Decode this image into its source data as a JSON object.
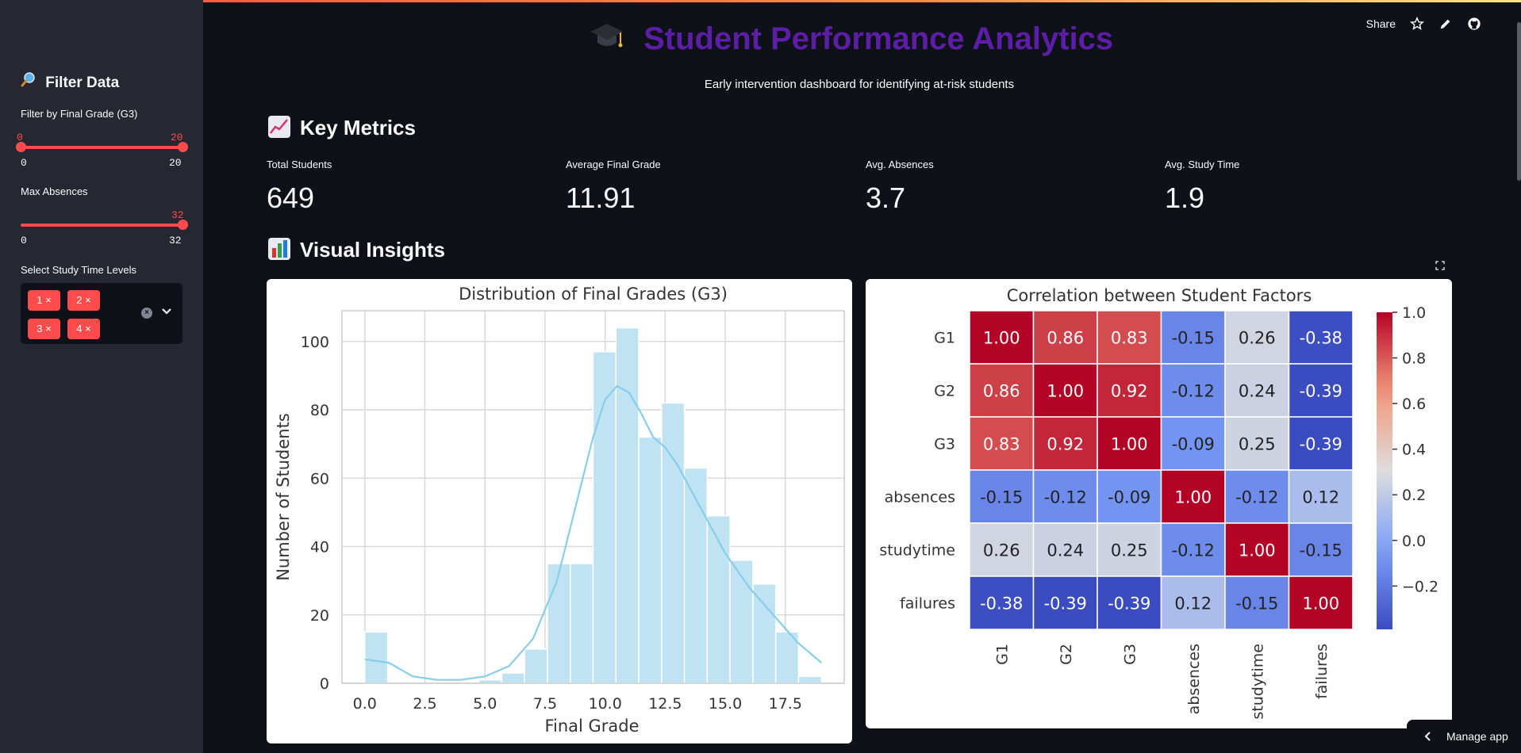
{
  "toolbar": {
    "share_label": "Share"
  },
  "sidebar": {
    "title": "Filter Data",
    "grade_filter": {
      "label": "Filter by Final Grade (G3)",
      "value_low": "0",
      "value_high": "20",
      "min": "0",
      "max": "20"
    },
    "absences_filter": {
      "label": "Max Absences",
      "value": "32",
      "min": "0",
      "max": "32"
    },
    "studytime_filter": {
      "label": "Select Study Time Levels",
      "chips": [
        "1",
        "2",
        "3",
        "4"
      ],
      "chip_close": "×"
    }
  },
  "header": {
    "icon": "graduation-cap-icon",
    "title": "Student Performance Analytics",
    "subtitle": "Early intervention dashboard for identifying at-risk students",
    "title_color": "#5d1ea7"
  },
  "key_metrics": {
    "title": "Key Metrics",
    "items": [
      {
        "label": "Total Students",
        "value": "649"
      },
      {
        "label": "Average Final Grade",
        "value": "11.91"
      },
      {
        "label": "Avg. Absences",
        "value": "3.7"
      },
      {
        "label": "Avg. Study Time",
        "value": "1.9"
      }
    ]
  },
  "visual_insights": {
    "title": "Visual Insights"
  },
  "manage_app_label": "Manage app",
  "accent_color": "#ff4b4b",
  "chart_data": [
    {
      "type": "bar",
      "title": "Distribution of Final Grades (G3)",
      "xlabel": "Final Grade",
      "ylabel": "Number of Students",
      "bin_edges": [
        0,
        0.95,
        1.9,
        2.85,
        3.8,
        4.75,
        5.7,
        6.65,
        7.6,
        8.55,
        9.5,
        10.45,
        11.4,
        12.35,
        13.3,
        14.25,
        15.2,
        16.15,
        17.1,
        18.05,
        19
      ],
      "values": [
        15,
        0,
        0,
        0,
        0,
        1,
        3,
        10,
        35,
        35,
        97,
        104,
        72,
        82,
        63,
        49,
        36,
        29,
        15,
        2
      ],
      "kde": {
        "x": [
          0,
          1,
          2,
          3,
          4,
          5,
          6,
          7,
          8,
          9,
          9.5,
          10,
          10.5,
          11,
          11.5,
          12,
          12.5,
          13,
          14,
          15,
          16,
          17,
          18,
          19
        ],
        "y": [
          7,
          6,
          2,
          1,
          1,
          2,
          5,
          13,
          30,
          58,
          72,
          83,
          87,
          85,
          79,
          72,
          69,
          64,
          51,
          38,
          28,
          20,
          12,
          6
        ]
      },
      "xlim": [
        -0.95,
        19.95
      ],
      "ylim": [
        0,
        109
      ],
      "xticks": [
        "0.0",
        "2.5",
        "5.0",
        "7.5",
        "10.0",
        "12.5",
        "15.0",
        "17.5"
      ],
      "yticks": [
        "0",
        "20",
        "40",
        "60",
        "80",
        "100"
      ],
      "grid": true,
      "bar_color": "#bfe3f2",
      "line_color": "#87ceeb"
    },
    {
      "type": "heatmap",
      "title": "Correlation between Student Factors",
      "rows": [
        "G1",
        "G2",
        "G3",
        "absences",
        "studytime",
        "failures"
      ],
      "cols": [
        "G1",
        "G2",
        "G3",
        "absences",
        "studytime",
        "failures"
      ],
      "values": [
        [
          1.0,
          0.86,
          0.83,
          -0.15,
          0.26,
          -0.38
        ],
        [
          0.86,
          1.0,
          0.92,
          -0.12,
          0.24,
          -0.39
        ],
        [
          0.83,
          0.92,
          1.0,
          -0.09,
          0.25,
          -0.39
        ],
        [
          -0.15,
          -0.12,
          -0.09,
          1.0,
          -0.12,
          0.12
        ],
        [
          0.26,
          0.24,
          0.25,
          -0.12,
          1.0,
          -0.15
        ],
        [
          -0.38,
          -0.39,
          -0.39,
          0.12,
          -0.15,
          1.0
        ]
      ],
      "colorbar": {
        "ticks": [
          "1.0",
          "0.8",
          "0.6",
          "0.4",
          "0.2",
          "0.0",
          "−0.2"
        ],
        "range": [
          -0.39,
          1.0
        ],
        "colormap": "coolwarm"
      }
    }
  ]
}
